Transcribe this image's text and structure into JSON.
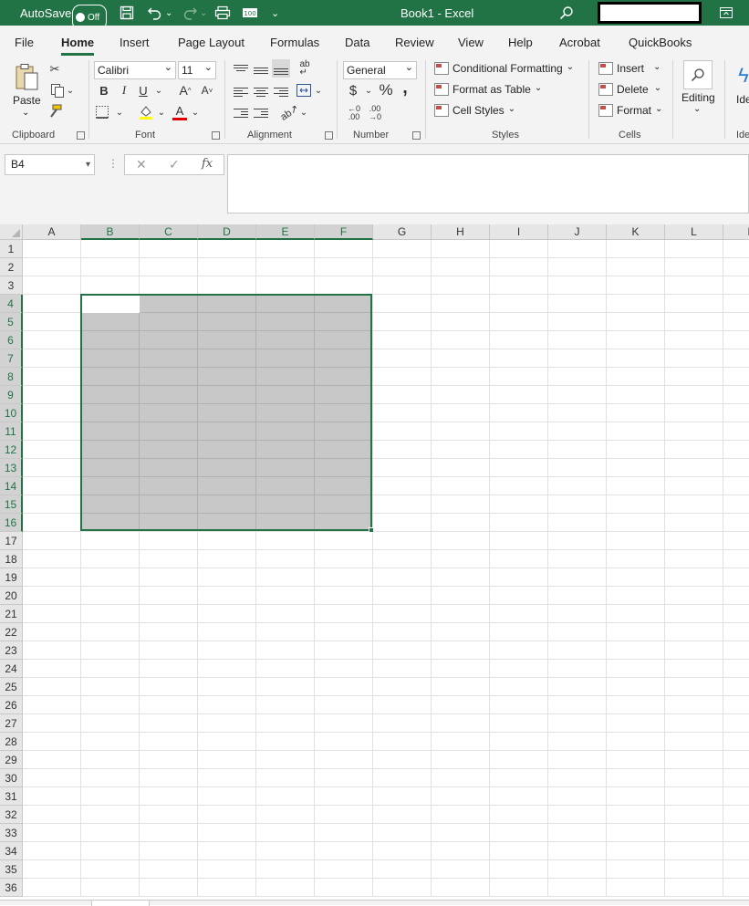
{
  "titlebar": {
    "autosave_label": "AutoSave",
    "autosave_state": "Off",
    "doc_title": "Book1  -  Excel",
    "accent_color": "#217346"
  },
  "tabs": [
    {
      "label": "File"
    },
    {
      "label": "Home"
    },
    {
      "label": "Insert"
    },
    {
      "label": "Page Layout"
    },
    {
      "label": "Formulas"
    },
    {
      "label": "Data"
    },
    {
      "label": "Review"
    },
    {
      "label": "View"
    },
    {
      "label": "Help"
    },
    {
      "label": "Acrobat"
    },
    {
      "label": "QuickBooks"
    }
  ],
  "ribbon": {
    "clipboard": {
      "paste": "Paste",
      "label": "Clipboard"
    },
    "font": {
      "name": "Calibri",
      "size": "11",
      "bold": "B",
      "italic": "I",
      "underline": "U",
      "grow": "A",
      "shrink": "A",
      "fill": "A",
      "color": "A",
      "label": "Font"
    },
    "alignment": {
      "label": "Alignment"
    },
    "number": {
      "format": "General",
      "currency": "$",
      "percent": "%",
      "comma": ",",
      "inc": "←0\n.00",
      "dec": ".00\n→0",
      "label": "Number"
    },
    "styles": {
      "conditional": "Conditional Formatting",
      "format_table": "Format as Table",
      "cell_styles": "Cell Styles",
      "label": "Styles"
    },
    "cells": {
      "insert": "Insert",
      "delete": "Delete",
      "format": "Format",
      "label": "Cells"
    },
    "editing": {
      "label": "Editing"
    },
    "ideas": {
      "label": "Ide",
      "label2": "Ide"
    }
  },
  "formula_bar": {
    "name_box": "B4",
    "cancel": "✕",
    "enter": "✓",
    "fx": "fx",
    "content": ""
  },
  "grid": {
    "columns": [
      "A",
      "B",
      "C",
      "D",
      "E",
      "F",
      "G",
      "H",
      "I",
      "J",
      "K",
      "L",
      "M"
    ],
    "rows": [
      "1",
      "2",
      "3",
      "4",
      "5",
      "6",
      "7",
      "8",
      "9",
      "10",
      "11",
      "12",
      "13",
      "14",
      "15",
      "16",
      "17",
      "18",
      "19",
      "20",
      "21",
      "22",
      "23",
      "24",
      "25",
      "26",
      "27",
      "28",
      "29",
      "30",
      "31",
      "32",
      "33",
      "34",
      "35",
      "36"
    ],
    "selected_columns": [
      "B",
      "C",
      "D",
      "E",
      "F"
    ],
    "selected_rows": [
      "4",
      "5",
      "6",
      "7",
      "8",
      "9",
      "10",
      "11",
      "12",
      "13",
      "14",
      "15",
      "16"
    ],
    "selection_range": "B4:F16",
    "active_cell": "B4"
  }
}
